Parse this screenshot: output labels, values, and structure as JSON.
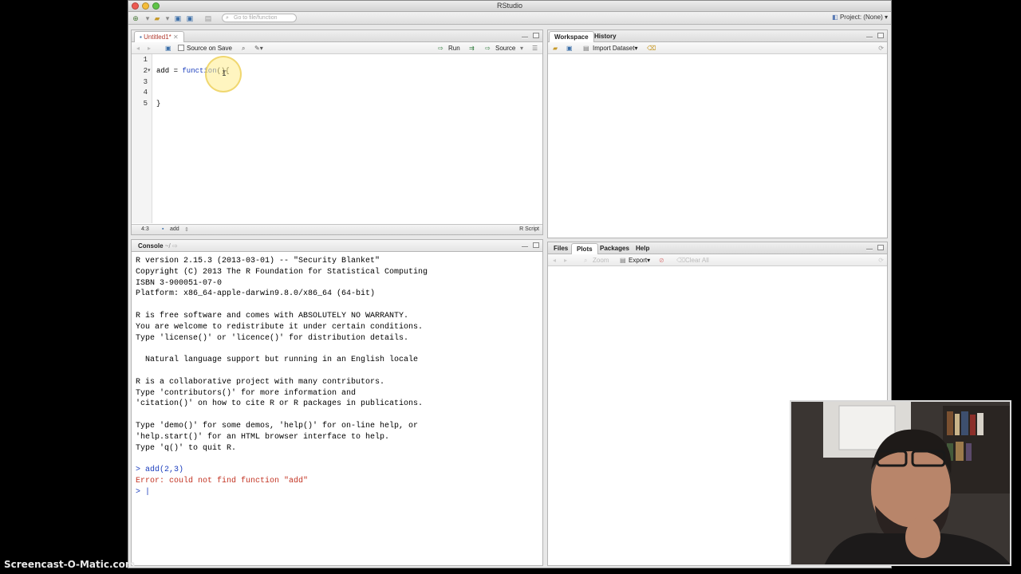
{
  "app": {
    "title": "RStudio",
    "project": "Project: (None) ▾"
  },
  "toolbar": {
    "goto_placeholder": "Go to file/function"
  },
  "editor": {
    "tab_label": "Untitled1*",
    "source_on_save": "Source on Save",
    "run_label": "Run",
    "source_label": "Source",
    "lines": [
      {
        "num": "1",
        "text": ""
      },
      {
        "num": "2",
        "text": "add = function(){"
      },
      {
        "num": "3",
        "text": ""
      },
      {
        "num": "4",
        "text": ""
      },
      {
        "num": "5",
        "text": "}"
      }
    ],
    "status_pos": "4:3",
    "status_func": "add",
    "status_type": "R Script"
  },
  "workspace": {
    "tab_workspace": "Workspace",
    "tab_history": "History",
    "import_label": "Import Dataset▾"
  },
  "console": {
    "tab_label": "Console",
    "path": "~/",
    "lines": [
      {
        "text": "R version 2.15.3 (2013-03-01) -- \"Security Blanket\"",
        "kind": "out"
      },
      {
        "text": "Copyright (C) 2013 The R Foundation for Statistical Computing",
        "kind": "out"
      },
      {
        "text": "ISBN 3-900051-07-0",
        "kind": "out"
      },
      {
        "text": "Platform: x86_64-apple-darwin9.8.0/x86_64 (64-bit)",
        "kind": "out"
      },
      {
        "text": "",
        "kind": "out"
      },
      {
        "text": "R is free software and comes with ABSOLUTELY NO WARRANTY.",
        "kind": "out"
      },
      {
        "text": "You are welcome to redistribute it under certain conditions.",
        "kind": "out"
      },
      {
        "text": "Type 'license()' or 'licence()' for distribution details.",
        "kind": "out"
      },
      {
        "text": "",
        "kind": "out"
      },
      {
        "text": "  Natural language support but running in an English locale",
        "kind": "out"
      },
      {
        "text": "",
        "kind": "out"
      },
      {
        "text": "R is a collaborative project with many contributors.",
        "kind": "out"
      },
      {
        "text": "Type 'contributors()' for more information and",
        "kind": "out"
      },
      {
        "text": "'citation()' on how to cite R or R packages in publications.",
        "kind": "out"
      },
      {
        "text": "",
        "kind": "out"
      },
      {
        "text": "Type 'demo()' for some demos, 'help()' for on-line help, or",
        "kind": "out"
      },
      {
        "text": "'help.start()' for an HTML browser interface to help.",
        "kind": "out"
      },
      {
        "text": "Type 'q()' to quit R.",
        "kind": "out"
      },
      {
        "text": "",
        "kind": "out"
      },
      {
        "text": "> add(2,3)",
        "kind": "cmd"
      },
      {
        "text": "Error: could not find function \"add\"",
        "kind": "err"
      },
      {
        "text": "> |",
        "kind": "cmd"
      }
    ]
  },
  "files": {
    "tabs": [
      "Files",
      "Plots",
      "Packages",
      "Help"
    ],
    "zoom_label": "Zoom",
    "export_label": "Export▾",
    "clear_label": "Clear All"
  },
  "watermark": "Screencast-O-Matic.com",
  "colors": {
    "keyword": "#1a3dbd",
    "error": "#c23221",
    "window_bg": "#e8e8e8"
  }
}
